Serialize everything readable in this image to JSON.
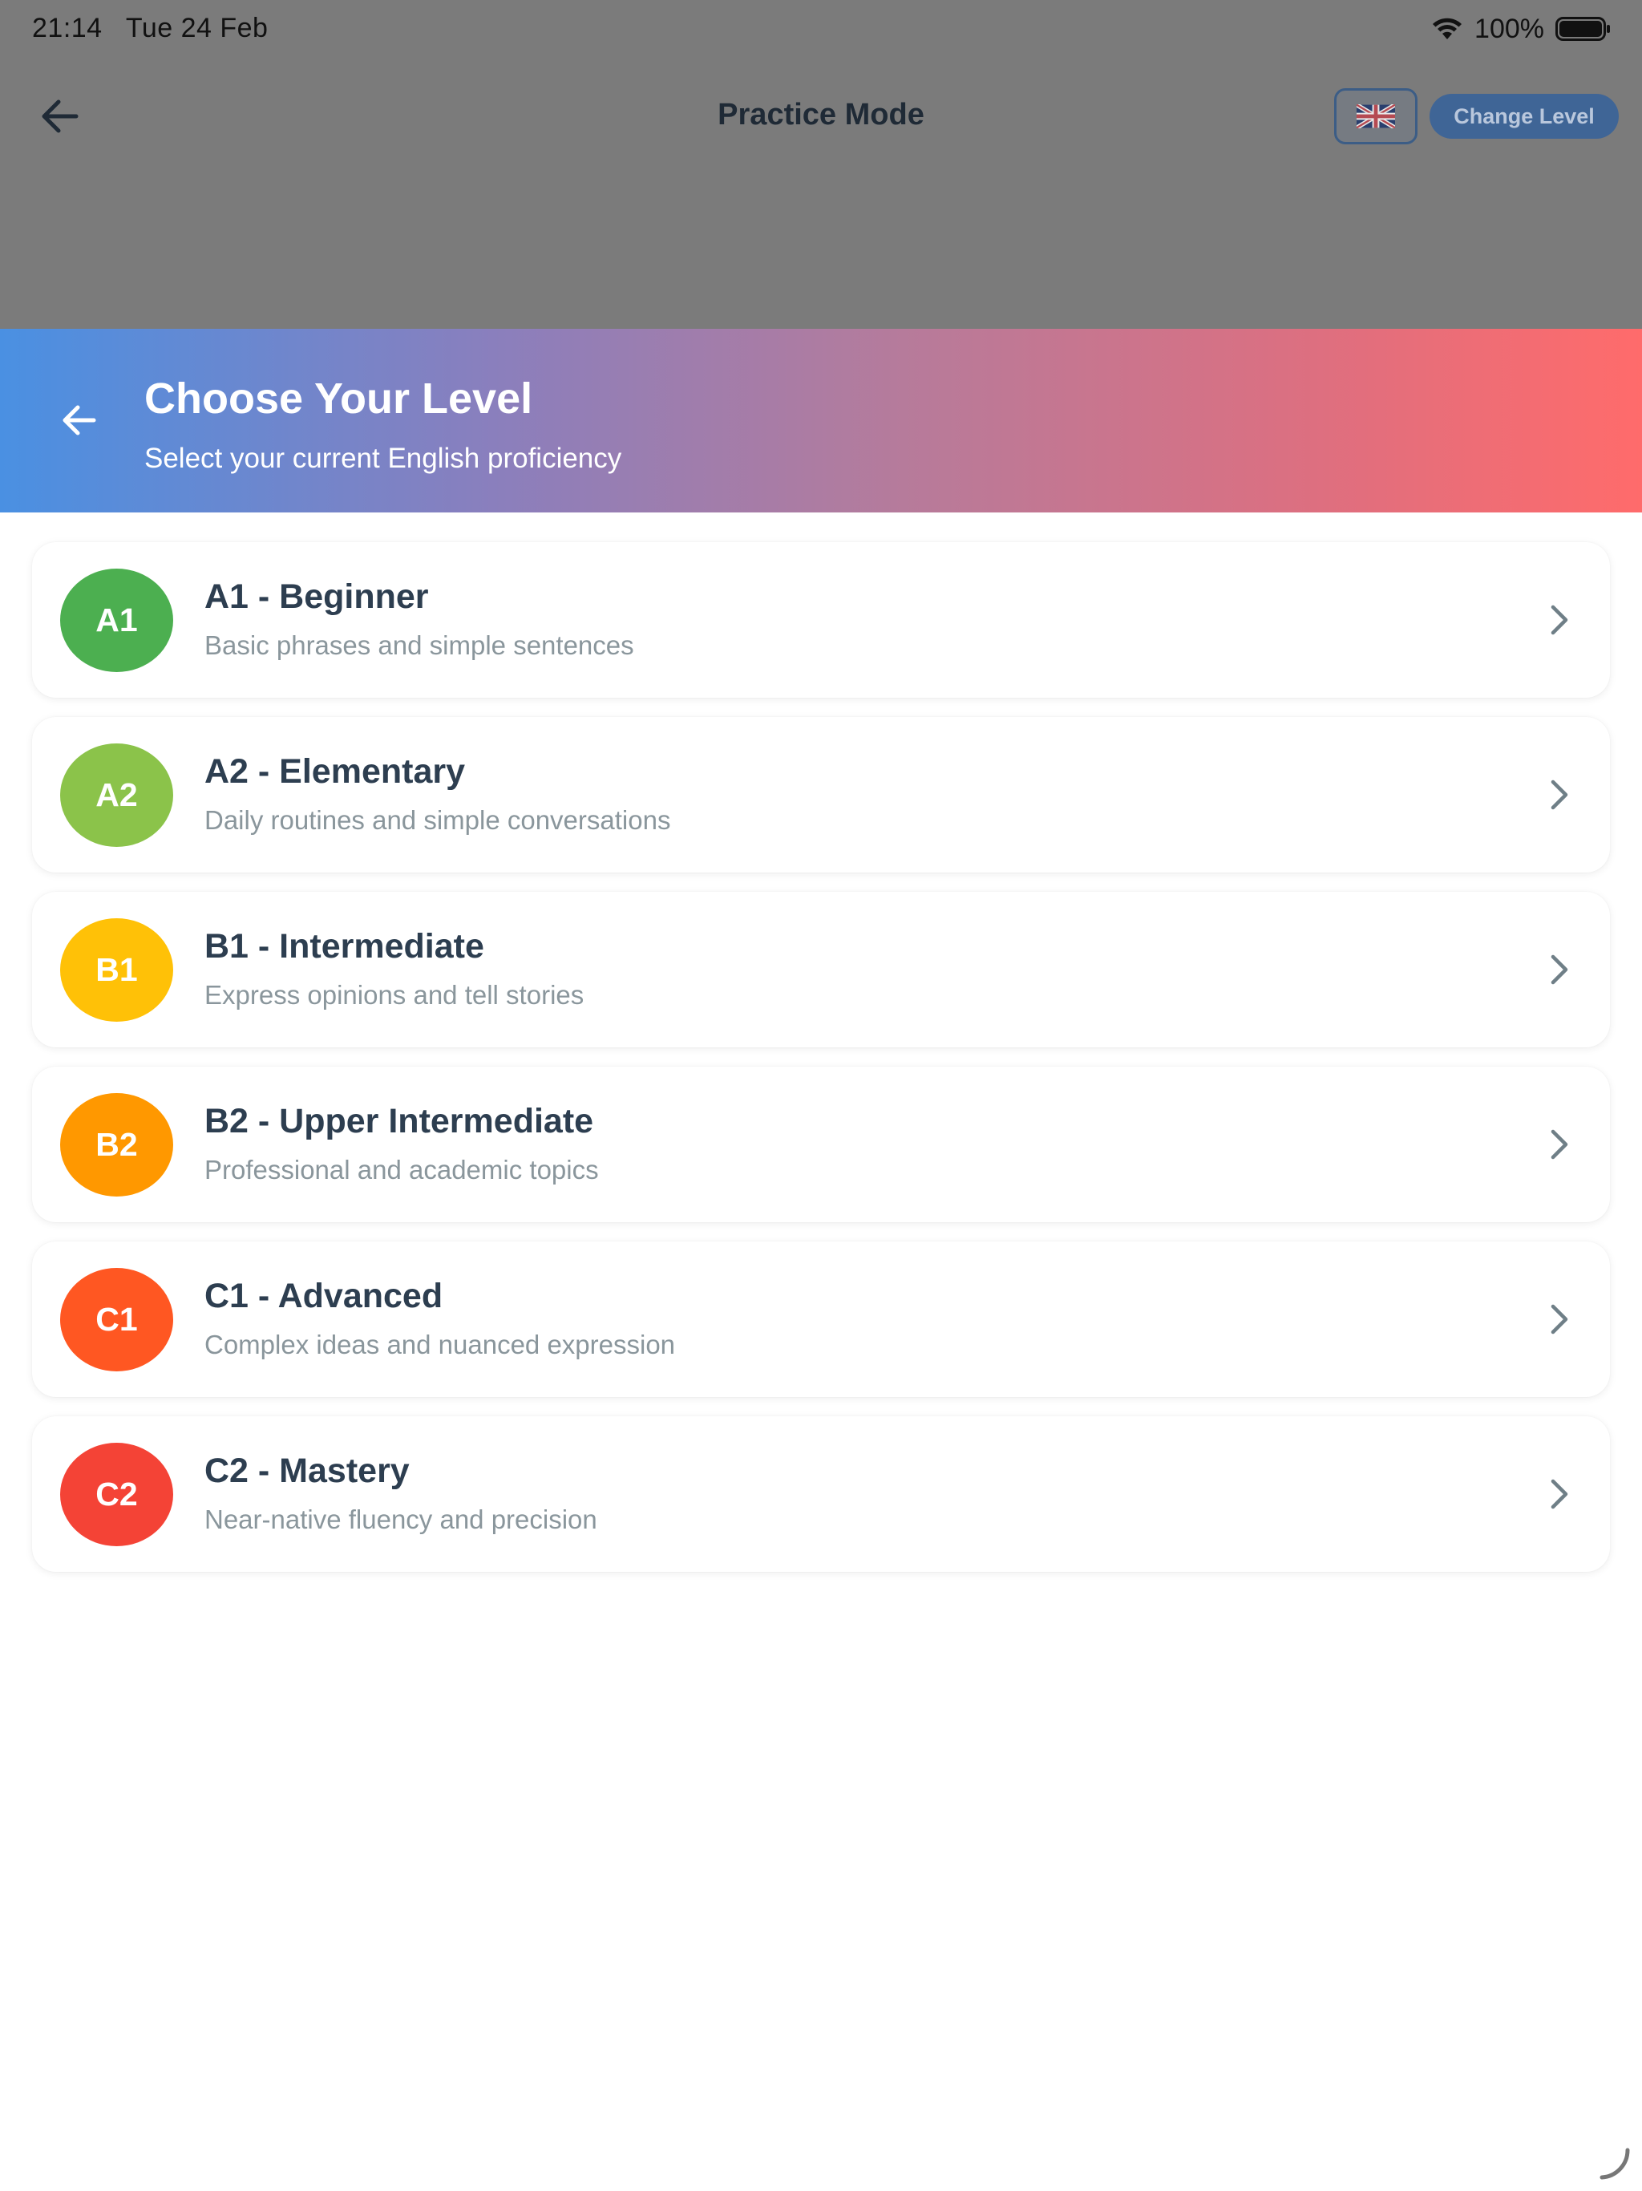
{
  "status_bar": {
    "time": "21:14",
    "date": "Tue 24 Feb",
    "battery_percent": "100%",
    "wifi_icon": "wifi-icon",
    "battery_icon": "battery-icon"
  },
  "nav": {
    "title": "Practice Mode",
    "back_icon": "arrow-left-icon",
    "flag_icon": "uk-flag-icon",
    "change_level_label": "Change Level"
  },
  "sheet": {
    "title": "Choose Your Level",
    "subtitle": "Select your current English proficiency",
    "back_icon": "arrow-left-icon"
  },
  "levels": [
    {
      "code": "A1",
      "title": "A1 - Beginner",
      "description": "Basic phrases and simple sentences",
      "color": "#4caf50"
    },
    {
      "code": "A2",
      "title": "A2 - Elementary",
      "description": "Daily routines and simple conversations",
      "color": "#8bc34a"
    },
    {
      "code": "B1",
      "title": "B1 - Intermediate",
      "description": "Express opinions and tell stories",
      "color": "#ffc107"
    },
    {
      "code": "B2",
      "title": "B2 - Upper Intermediate",
      "description": "Professional and academic topics",
      "color": "#ff9800"
    },
    {
      "code": "C1",
      "title": "C1 - Advanced",
      "description": "Complex ideas and nuanced expression",
      "color": "#ff5722"
    },
    {
      "code": "C2",
      "title": "C2 - Mastery",
      "description": "Near-native fluency and precision",
      "color": "#f44336"
    }
  ],
  "colors": {
    "backdrop": "#7b7b7b",
    "header_gradient_start": "#4a90e2",
    "header_gradient_end": "#ff6b6b",
    "title_text": "#2d3e50",
    "description_text": "#8a969c"
  }
}
